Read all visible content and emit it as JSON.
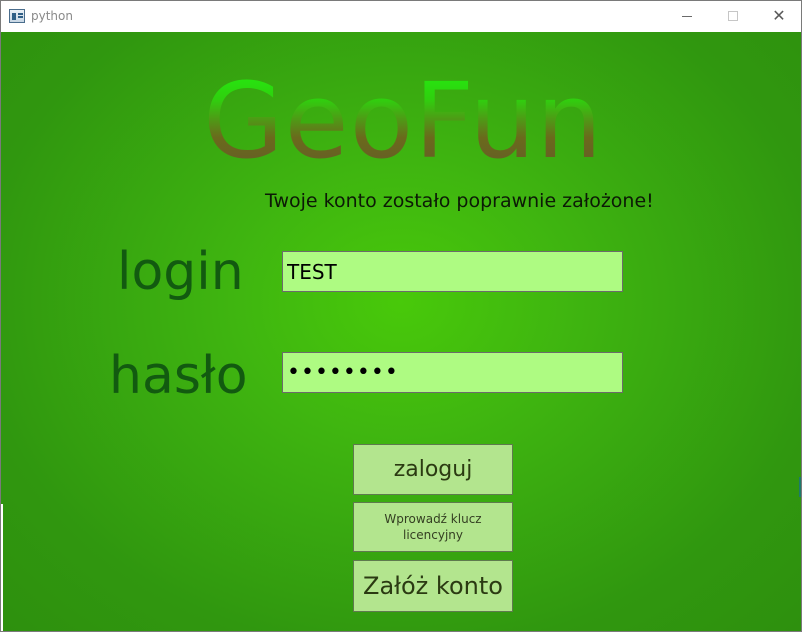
{
  "window": {
    "title": "python"
  },
  "app": {
    "logo_text": "GeoFun",
    "status_message": "Twoje konto zostało poprawnie założone!"
  },
  "form": {
    "login_label": "login",
    "login_value": "TEST",
    "password_label": "hasło",
    "password_value": "••••••••"
  },
  "buttons": {
    "login": "zaloguj",
    "license": "Wprowadź klucz licencyjny",
    "register": "Załóż konto"
  },
  "colors": {
    "background_green": "#3fb510",
    "input_fill": "#aefb82",
    "button_fill": "#b3e58e",
    "label_green": "#125a10"
  }
}
